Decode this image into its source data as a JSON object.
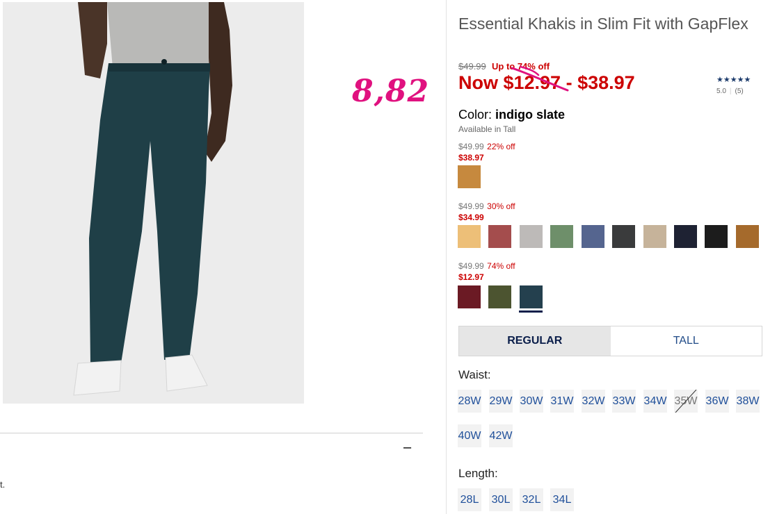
{
  "product": {
    "title": "Essential Khakis in Slim Fit with GapFlex",
    "original_price": "$49.99",
    "up_to_off": "Up to 74% off",
    "now_price": "Now $12.97 - $38.97",
    "handwritten_note": "8,82",
    "rating_stars": "★★★★★",
    "rating_value": "5.0",
    "rating_count": "(5)"
  },
  "color": {
    "label": "Color:",
    "selected": "indigo slate",
    "availability": "Available in Tall",
    "groups": [
      {
        "was": "$49.99",
        "off": "22% off",
        "sale": "$38.97",
        "swatches": [
          "#c6893e"
        ]
      },
      {
        "was": "$49.99",
        "off": "30% off",
        "sale": "$34.99",
        "swatches": [
          "#edbf78",
          "#a44d4d",
          "#bdbab8",
          "#6e8f6a",
          "#55658f",
          "#3a3b3c",
          "#c6b39a",
          "#1e2233",
          "#1c1c1c",
          "#a56a2c"
        ]
      },
      {
        "was": "$49.99",
        "off": "74% off",
        "sale": "$12.97",
        "swatches": [
          "#6b1a24",
          "#4c5430",
          "#24404e"
        ]
      }
    ]
  },
  "fit_tabs": {
    "regular": "REGULAR",
    "tall": "TALL"
  },
  "waist": {
    "label": "Waist:",
    "sizes": [
      "28W",
      "29W",
      "30W",
      "31W",
      "32W",
      "33W",
      "34W",
      "35W",
      "36W",
      "38W",
      "40W",
      "42W"
    ]
  },
  "length": {
    "label": "Length:",
    "sizes": [
      "28L",
      "30L",
      "32L",
      "34L"
    ]
  },
  "accordion": {
    "toggle": "–",
    "fragment": "t."
  },
  "colors": {
    "sale_red": "#cc0000",
    "link_blue": "#1f4f9a",
    "handwriting": "#e0117f"
  }
}
